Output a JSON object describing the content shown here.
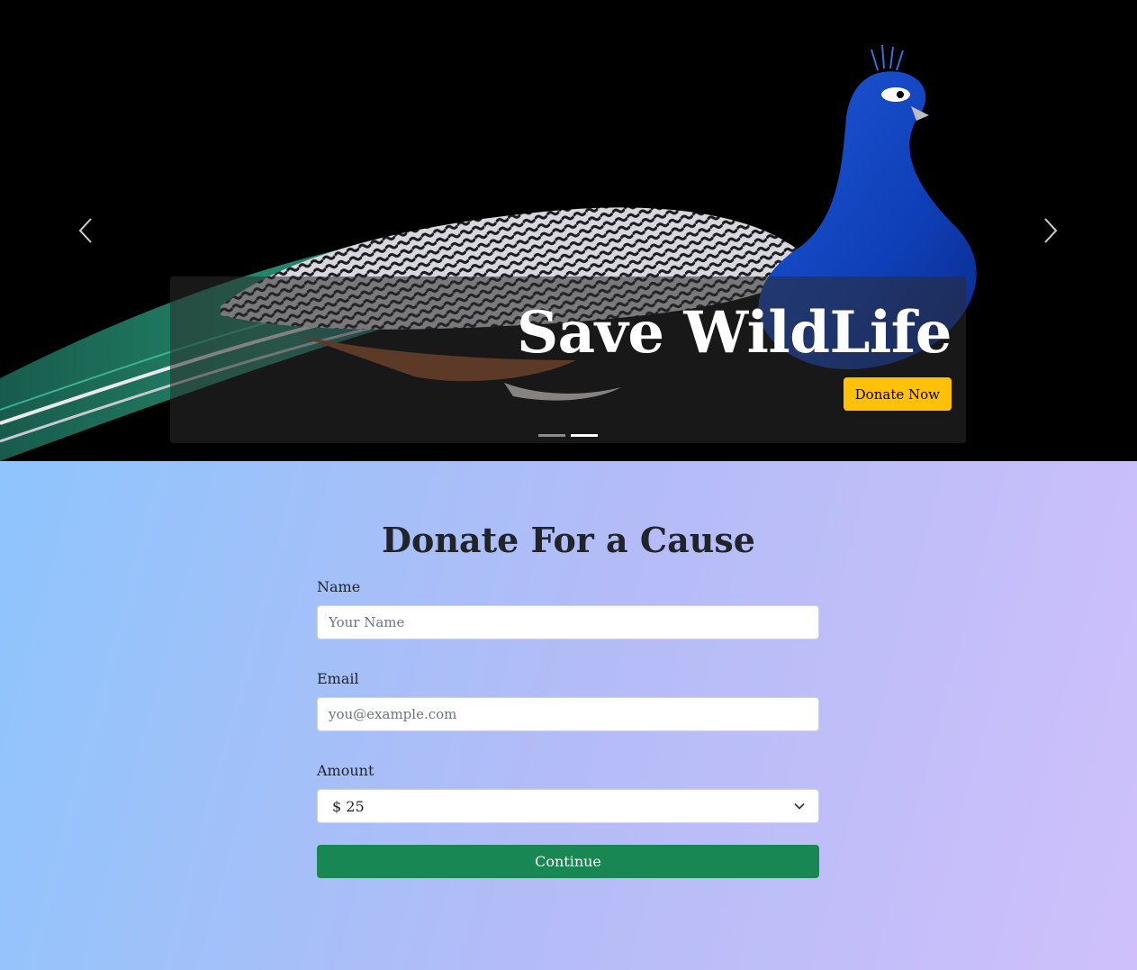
{
  "carousel": {
    "image_subject": "peacock",
    "caption_title": "Save WildLife",
    "cta_label": "Donate Now",
    "slide_count": 2,
    "active_slide": 2,
    "prev_icon": "chevron-left-icon",
    "next_icon": "chevron-right-icon"
  },
  "donation": {
    "heading": "Donate For a Cause",
    "name_label": "Name",
    "name_placeholder": "Your Name",
    "name_value": "",
    "email_label": "Email",
    "email_placeholder": "you@example.com",
    "email_value": "",
    "amount_label": "Amount",
    "amount_selected": "$ 25",
    "amount_icon": "chevron-down-icon",
    "continue_label": "Continue"
  },
  "colors": {
    "cta_yellow": "#ffc107",
    "continue_green": "#198754",
    "gradient_start": "#8ec5fc",
    "gradient_end": "#cfc0fb",
    "caption_overlay": "rgba(44,44,44,0.55)"
  }
}
